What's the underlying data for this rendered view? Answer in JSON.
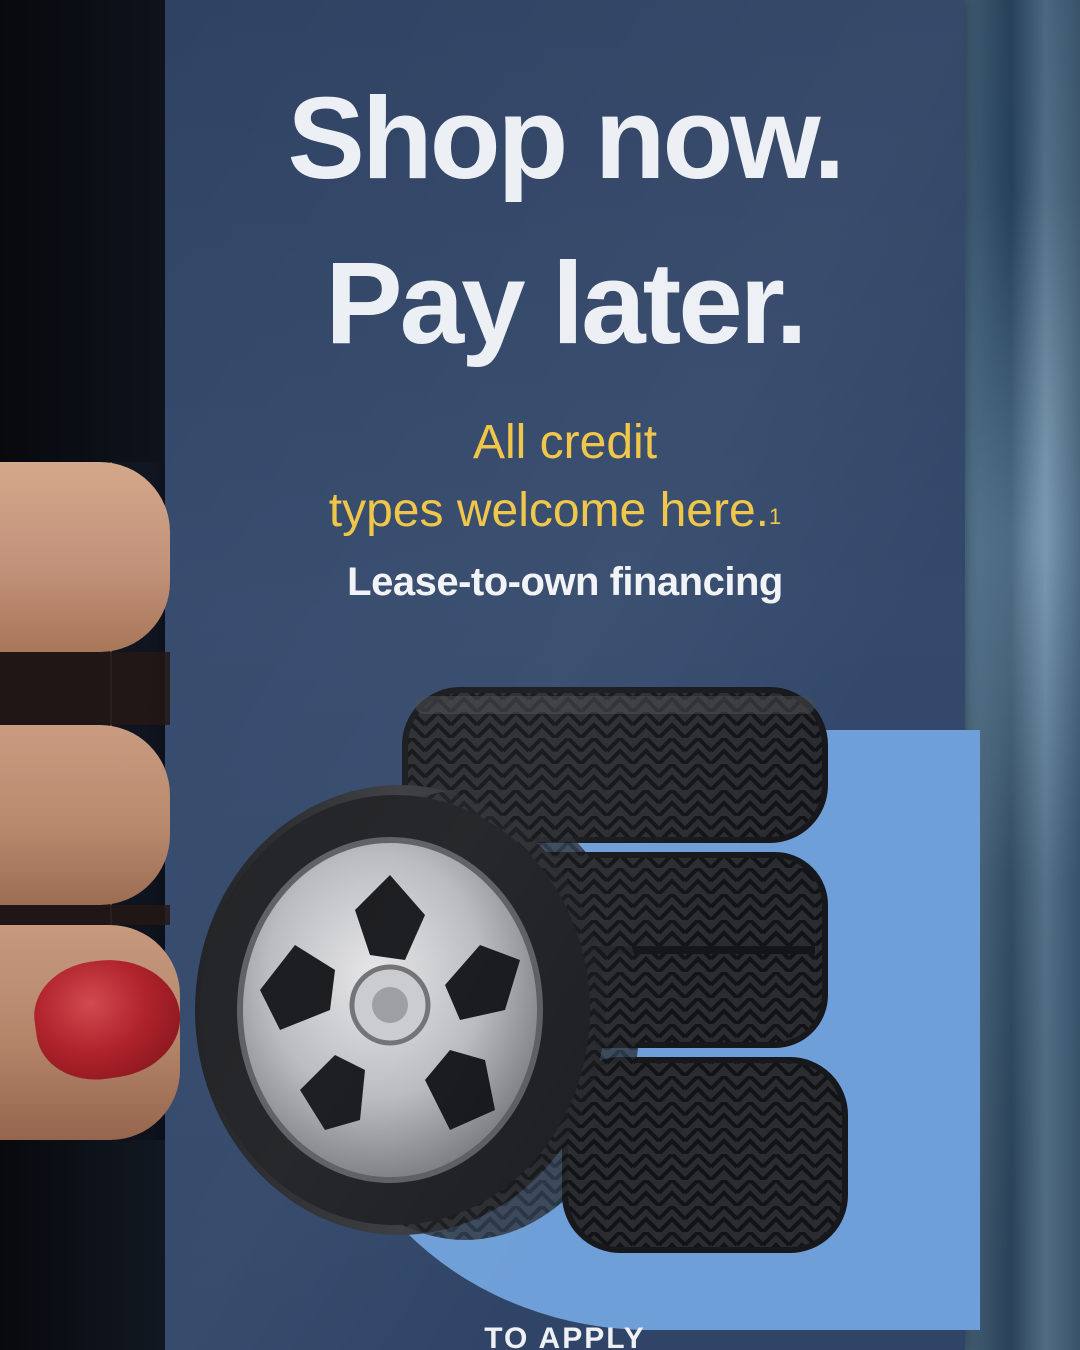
{
  "ad": {
    "headline_line1": "Shop now.",
    "headline_line2": "Pay later.",
    "subhead_line1": "All credit",
    "subhead_line2": "types welcome here.",
    "footnote_marker": "1",
    "tagline": "Lease-to-own financing",
    "apply_text": "TO APPLY"
  },
  "colors": {
    "card_background": "#34496c",
    "headline": "#eceff4",
    "subhead": "#f0c544",
    "accent_circle": "#6f9fd8",
    "nail_polish": "#b0232c"
  }
}
